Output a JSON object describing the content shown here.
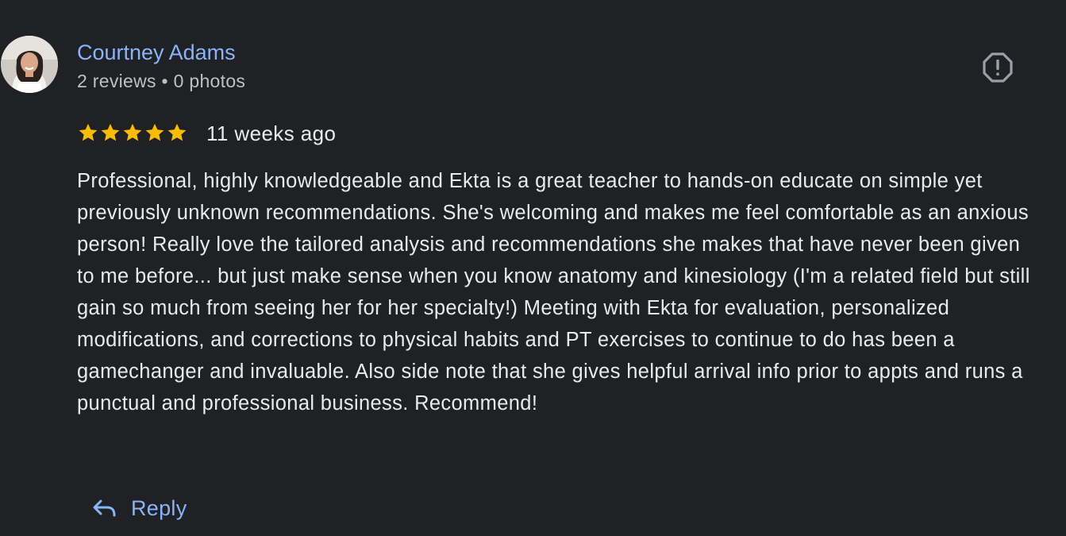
{
  "review": {
    "author": {
      "name": "Courtney Adams",
      "meta": "2 reviews • 0 photos",
      "avatar_icon": "profile-photo"
    },
    "rating": {
      "stars": 5,
      "max_stars": 5,
      "star_color": "#fbbc04"
    },
    "date": "11 weeks ago",
    "text": "Professional, highly knowledgeable and Ekta is a great teacher to hands-on educate on simple yet previously unknown recommendations. She's welcoming and makes me feel comfortable as an anxious person! Really love the tailored analysis and recommendations she makes that have never been given to me before... but just make sense when you know anatomy and kinesiology (I'm a related field but still gain so much from seeing her for her specialty!) Meeting with Ekta for evaluation, personalized modifications, and corrections to physical habits and PT exercises to continue to do has been a gamechanger and invaluable. Also side note that she gives helpful arrival info prior to appts and runs a punctual and professional business. Recommend!",
    "flag_icon": "report-icon",
    "reply": {
      "label": "Reply",
      "icon": "reply-icon"
    }
  },
  "colors": {
    "background": "#202124",
    "link": "#8ab4f8",
    "text": "#e8eaed",
    "secondary_text": "#bdc1c6",
    "icon": "#9aa0a6"
  }
}
